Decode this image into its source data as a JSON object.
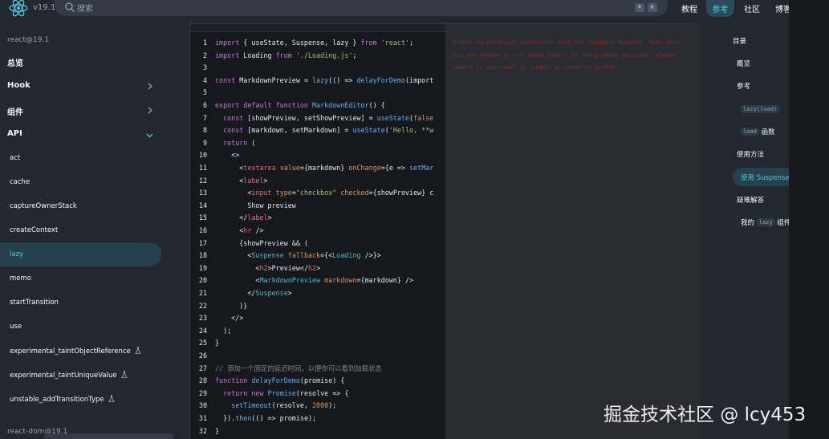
{
  "header": {
    "version": "v19.1",
    "search_placeholder": "搜索",
    "search_shortcut": [
      "⌘",
      "K"
    ],
    "nav": [
      "教程",
      "参考",
      "社区",
      "博客"
    ],
    "nav_active": "参考"
  },
  "sidebar": {
    "section": "react@19.1",
    "overview": "总览",
    "groups": [
      {
        "label": "Hook",
        "expanded": false
      },
      {
        "label": "组件",
        "expanded": false
      },
      {
        "label": "API",
        "expanded": true
      }
    ],
    "api_items": [
      {
        "label": "act",
        "experimental": false
      },
      {
        "label": "cache",
        "experimental": false
      },
      {
        "label": "captureOwnerStack",
        "experimental": false
      },
      {
        "label": "createContext",
        "experimental": false
      },
      {
        "label": "lazy",
        "experimental": false,
        "active": true
      },
      {
        "label": "memo",
        "experimental": false
      },
      {
        "label": "startTransition",
        "experimental": false
      },
      {
        "label": "use",
        "experimental": false
      },
      {
        "label": "experimental_taintObjectReference",
        "experimental": true
      },
      {
        "label": "experimental_taintUniqueValue",
        "experimental": true
      },
      {
        "label": "unstable_addTransitionType",
        "experimental": true
      }
    ],
    "next_section": "react-dom@19.1"
  },
  "code": {
    "line_numbers": [
      "1",
      "2",
      "3",
      "4",
      "5",
      "6",
      "7",
      "8",
      "9",
      "10",
      "11",
      "12",
      "13",
      "14",
      "15",
      "16",
      "17",
      "18",
      "19",
      "20",
      "21",
      "22",
      "23",
      "24",
      "25",
      "26",
      "27",
      "28",
      "29",
      "30",
      "31",
      "32"
    ],
    "lines": [
      [
        [
          "import ",
          "k"
        ],
        [
          "{ useState, Suspense, lazy } ",
          "p"
        ],
        [
          "from ",
          "k"
        ],
        [
          "'react'",
          "s"
        ],
        [
          ";",
          "p"
        ]
      ],
      [
        [
          "import ",
          "k"
        ],
        [
          "Loading ",
          "p"
        ],
        [
          "from ",
          "k"
        ],
        [
          "'./Loading.js'",
          "s"
        ],
        [
          ";",
          "p"
        ]
      ],
      [],
      [
        [
          "const ",
          "k"
        ],
        [
          "MarkdownPreview = ",
          "p"
        ],
        [
          "lazy",
          "f"
        ],
        [
          "(() => ",
          "p"
        ],
        [
          "delayForDemo",
          "f"
        ],
        [
          "(import",
          "p"
        ]
      ],
      [],
      [
        [
          "export default function ",
          "k"
        ],
        [
          "MarkdownEditor",
          "f"
        ],
        [
          "() {",
          "p"
        ]
      ],
      [
        [
          "  const ",
          "k"
        ],
        [
          "[showPreview, setShowPreview] = ",
          "p"
        ],
        [
          "useState",
          "f"
        ],
        [
          "(",
          "p"
        ],
        [
          "false",
          "n"
        ]
      ],
      [
        [
          "  const ",
          "k"
        ],
        [
          "[markdown, setMarkdown] = ",
          "p"
        ],
        [
          "useState",
          "f"
        ],
        [
          "(",
          "p"
        ],
        [
          "'Hello, **w",
          "s"
        ]
      ],
      [
        [
          "  return ",
          "k"
        ],
        [
          "(",
          "p"
        ]
      ],
      [
        [
          "    <>",
          "p"
        ]
      ],
      [
        [
          "      <",
          "p"
        ],
        [
          "textarea ",
          "t"
        ],
        [
          "value",
          "n"
        ],
        [
          "={markdown} ",
          "p"
        ],
        [
          "onChange",
          "n"
        ],
        [
          "={e => ",
          "p"
        ],
        [
          "setMar",
          "f"
        ]
      ],
      [
        [
          "      <",
          "p"
        ],
        [
          "label",
          "t"
        ],
        [
          ">",
          "p"
        ]
      ],
      [
        [
          "        <",
          "p"
        ],
        [
          "input ",
          "t"
        ],
        [
          "type",
          "n"
        ],
        [
          "=",
          "p"
        ],
        [
          "\"checkbox\" ",
          "s"
        ],
        [
          "checked",
          "n"
        ],
        [
          "={showPreview} c",
          "p"
        ]
      ],
      [
        [
          "        Show preview",
          "p"
        ]
      ],
      [
        [
          "      </",
          "p"
        ],
        [
          "label",
          "t"
        ],
        [
          ">",
          "p"
        ]
      ],
      [
        [
          "      <",
          "p"
        ],
        [
          "hr ",
          "t"
        ],
        [
          "/>",
          "p"
        ]
      ],
      [
        [
          "      {showPreview && (",
          "p"
        ]
      ],
      [
        [
          "        <",
          "p"
        ],
        [
          "Suspense ",
          "o"
        ],
        [
          "fallback",
          "n"
        ],
        [
          "={<",
          "p"
        ],
        [
          "Loading ",
          "o"
        ],
        [
          "/>}>",
          "p"
        ]
      ],
      [
        [
          "          <",
          "p"
        ],
        [
          "h2",
          "t"
        ],
        [
          ">Preview</",
          "p"
        ],
        [
          "h2",
          "t"
        ],
        [
          ">",
          "p"
        ]
      ],
      [
        [
          "          <",
          "p"
        ],
        [
          "MarkdownPreview ",
          "o"
        ],
        [
          "markdown",
          "n"
        ],
        [
          "={markdown} />",
          "p"
        ]
      ],
      [
        [
          "        </",
          "p"
        ],
        [
          "Suspense",
          "o"
        ],
        [
          ">",
          "p"
        ]
      ],
      [
        [
          "      )}",
          "p"
        ]
      ],
      [
        [
          "    </>",
          "p"
        ]
      ],
      [
        [
          "  );",
          "p"
        ]
      ],
      [
        [
          "}",
          "p"
        ]
      ],
      [],
      [
        [
          "// 添加一个固定的延迟时间，以便你可以看到加载状态",
          "c"
        ]
      ],
      [
        [
          "function ",
          "k"
        ],
        [
          "delayForDemo",
          "f"
        ],
        [
          "(promise) {",
          "p"
        ]
      ],
      [
        [
          "  return new ",
          "k"
        ],
        [
          "Promise",
          "f"
        ],
        [
          "(resolve => {",
          "p"
        ]
      ],
      [
        [
          "    ",
          "p"
        ],
        [
          "setTimeout",
          "f"
        ],
        [
          "(resolve, ",
          "p"
        ],
        [
          "2000",
          "n"
        ],
        [
          ");",
          "p"
        ]
      ],
      [
        [
          "  }).",
          "p"
        ],
        [
          "then",
          "f"
        ],
        [
          "(() => promise);",
          "p"
        ]
      ],
      [
        [
          "}",
          "p"
        ]
      ]
    ]
  },
  "preview": {
    "error_text": "Unable to establish connection with the sandpack bundler. Make sure you are online or try again later. If the problem persists, please report it via email or submit an issue on GitHub."
  },
  "toc": {
    "title": "目录",
    "items": [
      {
        "text": "概览",
        "code": "",
        "suffix": "",
        "level": 1
      },
      {
        "text": "参考",
        "code": "",
        "suffix": "",
        "level": 1
      },
      {
        "text": "",
        "code": "lazy(load)",
        "suffix": "",
        "level": 2
      },
      {
        "text": "",
        "code": "load",
        "suffix": " 函数",
        "level": 2
      },
      {
        "text": "使用方法",
        "code": "",
        "suffix": "",
        "level": 1
      },
      {
        "text": "使用 Suspense",
        "code": "",
        "suffix": "",
        "level": 2,
        "active": true
      },
      {
        "text": "疑难解答",
        "code": "",
        "suffix": "",
        "level": 1
      },
      {
        "text": "我的 ",
        "code": "lazy",
        "suffix": " 组件",
        "level": 2
      }
    ]
  },
  "watermark": "掘金技术社区 @ lcy453",
  "colors": {
    "accent": "#58c4dc",
    "background": "#23272f",
    "code_background": "#16181d",
    "error_text": "#a62a2a"
  }
}
